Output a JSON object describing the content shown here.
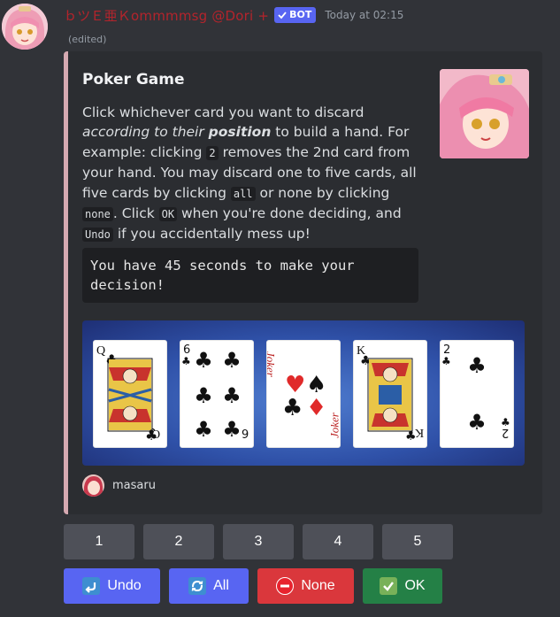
{
  "message": {
    "username": "ｂツＥ亜Ｋommmmsg @Dori +",
    "bot_badge": "BOT",
    "timestamp": "Today at 02:15",
    "edited": "(edited)"
  },
  "embed": {
    "title": "Poker Game",
    "desc": {
      "t1": "Click whichever card you want to discard ",
      "em1": "according to their ",
      "strong_em": "position",
      "t2": " to build a hand. For example: clicking ",
      "code1": "2",
      "t3": " removes the 2nd card from your hand. You may discard one to five cards, all five cards by clicking ",
      "code2": "all",
      "t4": " or none by clicking ",
      "code3": "none",
      "t5": ". Click ",
      "code4": "OK",
      "t6": " when you're done deciding, and ",
      "code5": "Undo",
      "t7": " if you accidentally mess up!"
    },
    "codeblock": "You have 45 seconds to make your decision!",
    "cards": [
      {
        "rank": "Q",
        "suit": "clubs",
        "name": "queen-of-clubs"
      },
      {
        "rank": "6",
        "suit": "clubs",
        "name": "six-of-clubs"
      },
      {
        "rank": "Joker",
        "suit": "joker",
        "name": "joker"
      },
      {
        "rank": "K",
        "suit": "clubs",
        "name": "king-of-clubs"
      },
      {
        "rank": "2",
        "suit": "clubs",
        "name": "two-of-clubs"
      }
    ],
    "footer_text": "masaru",
    "accent_color": "#d5a9b1"
  },
  "buttons": {
    "numbers": [
      "1",
      "2",
      "3",
      "4",
      "5"
    ],
    "undo": "Undo",
    "all": "All",
    "none": "None",
    "ok": "OK"
  },
  "colors": {
    "background": "#313338",
    "embed_bg": "#2b2d31",
    "grey_button": "#4e5058",
    "blurple": "#5865f2",
    "danger": "#da373c",
    "success": "#248046",
    "username": "#b3242c"
  }
}
